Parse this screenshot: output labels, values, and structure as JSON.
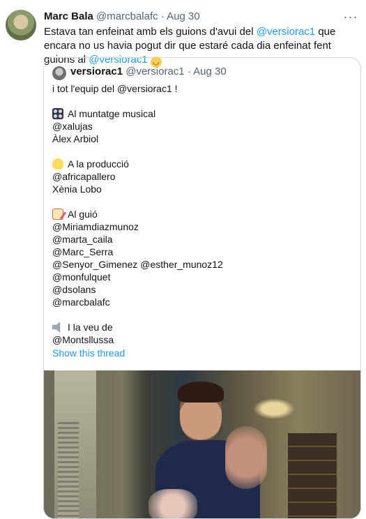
{
  "tweet": {
    "author_name": "Marc Bala",
    "author_handle": "@marcbalafc",
    "separator": "·",
    "time": "Aug 30",
    "more_label": "···",
    "text_1": "Estava tan enfeinat amb els guions d'avui del ",
    "mention_1": "@versiorac1",
    "text_2": " que encara no us havia pogut dir que estaré cada dia enfeinat fent guions al ",
    "mention_2": "@versiorac1",
    "emoji_icon": "upside-down-face-icon"
  },
  "quote": {
    "author_name": "versiorac1",
    "author_handle": "@versiorac1",
    "separator": "·",
    "time": "Aug 30",
    "intro": "i tot l'equip del @versiorac1 !",
    "sections": [
      {
        "icon": "control-knobs-icon",
        "title": "Al muntatge musical",
        "lines": [
          "@xalujas",
          "Àlex Arbiol"
        ]
      },
      {
        "icon": "clapper-icon",
        "title": "A la producció",
        "lines": [
          "@africapallero",
          "Xènia Lobo"
        ]
      },
      {
        "icon": "memo-icon",
        "title": "Al guió",
        "lines": [
          "@Miriamdiazmunoz",
          "@marta_caila",
          "@Marc_Serra",
          "@Senyor_Gimenez  @esther_munoz12",
          "@monfulquet",
          "@dsolans",
          "@marcbalafc"
        ]
      },
      {
        "icon": "speaker-icon",
        "title": "I la veu de",
        "lines": [
          "@Montsllussa"
        ]
      }
    ],
    "show_thread": "Show this thread"
  },
  "colors": {
    "text": "#0f1419",
    "secondary": "#536471",
    "link": "#1d9bf0",
    "border": "#cfd9de"
  }
}
